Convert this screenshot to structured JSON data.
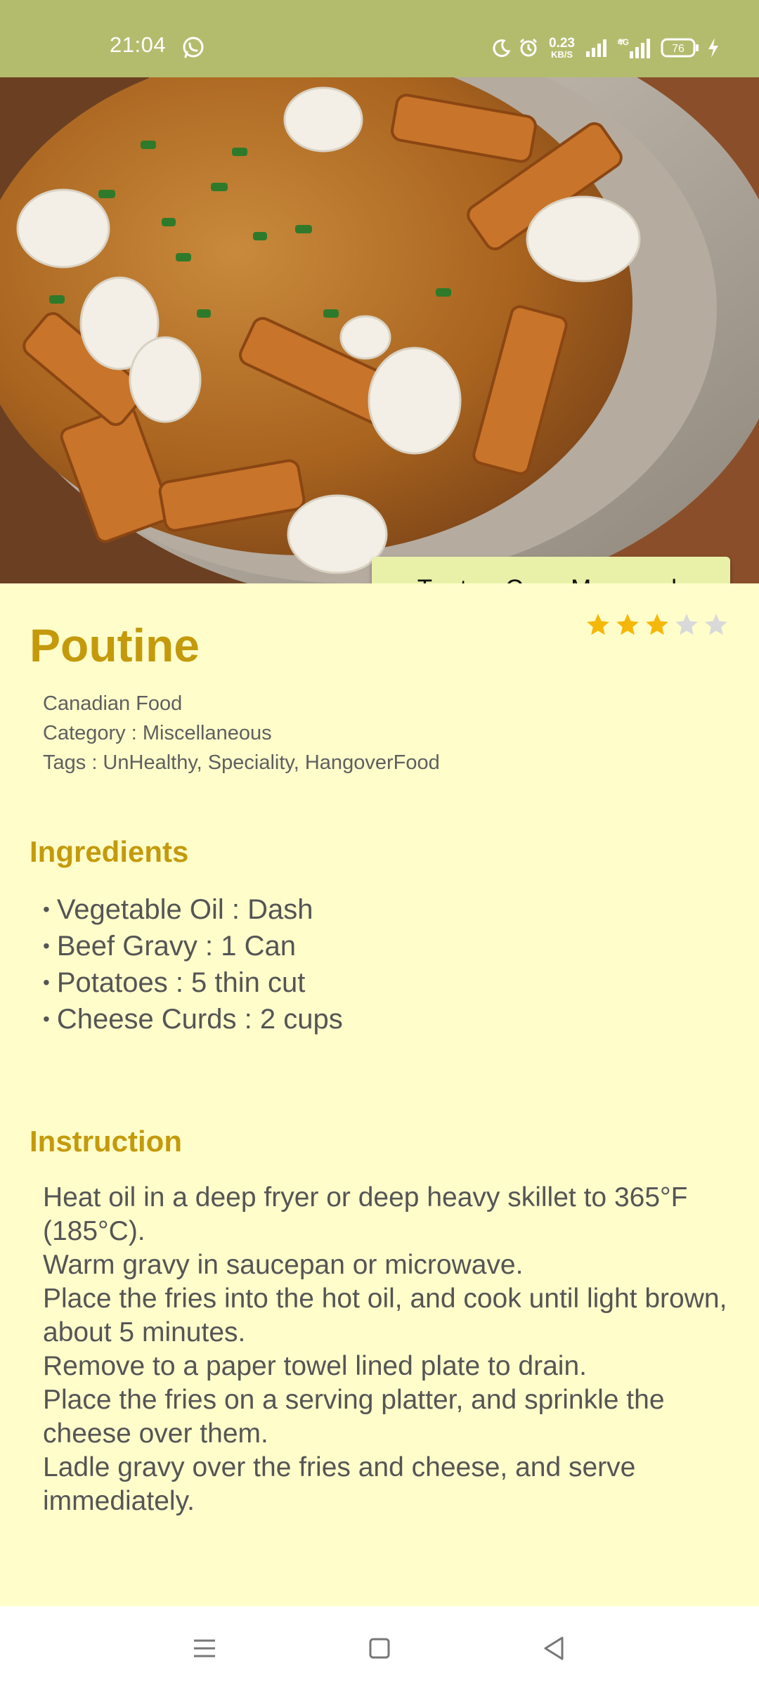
{
  "status_bar": {
    "time": "21:04",
    "net_speed_value": "0.23",
    "net_speed_unit": "KB/S",
    "battery": "76",
    "icons": [
      "whatsapp-icon",
      "moon-icon",
      "alarm-icon",
      "signal-icon",
      "signal-4g-icon",
      "battery-icon",
      "charging-icon"
    ]
  },
  "hero": {
    "image_subject": "poutine-photo",
    "watch_button_label": "Tonton Cara Memasak"
  },
  "recipe": {
    "title": "Poutine",
    "rating": 3,
    "rating_max": 5,
    "area": "Canadian Food",
    "category": "Category : Miscellaneous",
    "tags": "Tags : UnHealthy, Speciality, HangoverFood"
  },
  "ingredients": {
    "heading": "Ingredients",
    "items": [
      "Vegetable Oil : Dash",
      "Beef Gravy : 1 Can",
      "Potatoes : 5 thin cut",
      "Cheese Curds : 2 cups"
    ]
  },
  "instruction": {
    "heading": "Instruction",
    "lines": [
      "Heat oil in a deep fryer or deep heavy skillet to 365°F (185°C).",
      "Warm gravy in saucepan or microwave.",
      "Place the fries into the hot oil, and cook until light brown, about 5 minutes.",
      "Remove to a paper towel lined plate to drain.",
      "Place the fries on a serving platter, and sprinkle the cheese over them.",
      "Ladle gravy over the fries and cheese, and serve immediately."
    ]
  },
  "colors": {
    "status_bar": "#B3BC6D",
    "page_background": "#FFFECB",
    "accent": "#C49A0C",
    "button": "#E9F1A8",
    "star_filled": "#F5B70A",
    "star_empty": "#D9D9D9"
  },
  "nav_bar": {
    "icons": [
      "menu-icon",
      "home-icon",
      "back-icon"
    ]
  }
}
